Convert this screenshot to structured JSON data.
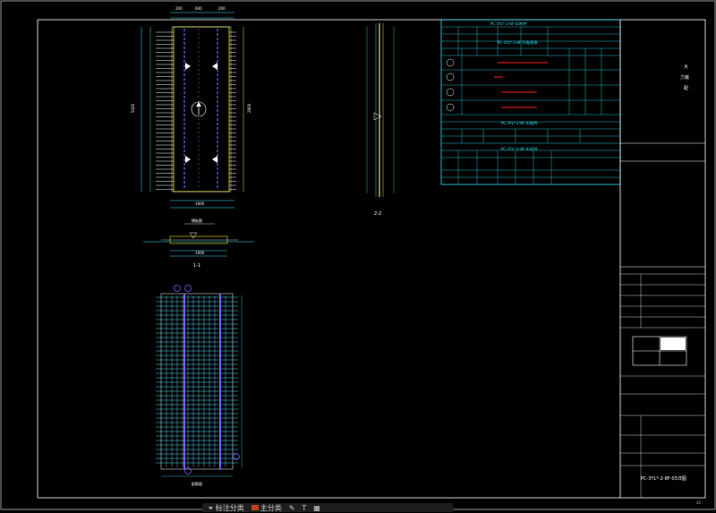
{
  "colors": {
    "background": "#000000",
    "frame": "#ffffff",
    "cyan": "#2ee6ff",
    "yellow": "#f2e600",
    "green": "#46e84b",
    "red": "#ff2020",
    "purple": "#7a5cff",
    "magenta": "#ff3bff"
  },
  "title_block": {
    "company_line1": "大",
    "company_line2": "力装",
    "company_line3": "配",
    "drawing_title": "PC-3YL*-2-8F-03详图",
    "sheet_number": "42"
  },
  "drawing": {
    "view_1": "1-1",
    "view_2": "2-2",
    "elevation_label": "模板图",
    "rebar_label": "配筋图"
  },
  "schedule": {
    "title_main": "PC-3YL*-2-8F-03构件",
    "title_rebar": "PC-3YL*-2-8F-03配筋表",
    "title_embed": "PC-3YL*-2-8F-03配件",
    "title_lift": "PC-3YL*-2-8F-03吊件"
  },
  "statusbar": {
    "tool_label": "标注分类",
    "layer_label": "主分类"
  }
}
